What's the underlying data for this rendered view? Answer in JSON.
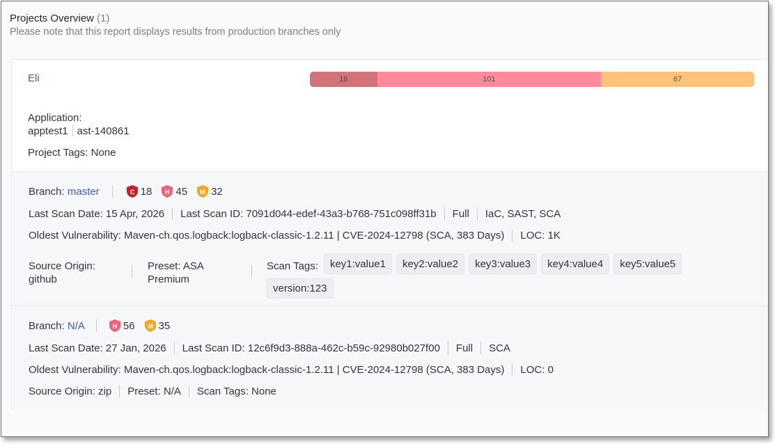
{
  "header": {
    "title": "Projects Overview",
    "count": "(1)",
    "subtitle": "Please note that this report displays results from production branches only"
  },
  "project": {
    "name": "Eli",
    "severity_bar": {
      "critical": 18,
      "high": 101,
      "medium": 67,
      "colors": {
        "critical": "#d2737a",
        "high": "#ff8a9c",
        "medium": "#ffc37a"
      }
    },
    "application_label": "Application:",
    "applications": [
      "apptest1",
      "ast-140861"
    ],
    "project_tags_label": "Project Tags:",
    "project_tags_value": "None"
  },
  "branches": [
    {
      "branch_label": "Branch:",
      "branch_name": "master",
      "severities": [
        {
          "letter": "C",
          "count": "18",
          "color": "#c4202b"
        },
        {
          "letter": "H",
          "count": "45",
          "color": "#f0627a"
        },
        {
          "letter": "M",
          "count": "32",
          "color": "#f5a623"
        }
      ],
      "last_scan_date": "Last Scan Date: 15 Apr, 2026",
      "last_scan_id": "Last Scan ID: 7091d044-edef-43a3-b768-751c098ff31b",
      "scan_type": "Full",
      "engines": "IaC, SAST, SCA",
      "oldest_vuln": "Oldest Vulnerability: Maven-ch.qos.logback:logback-classic-1.2.11 | CVE-2024-12798 (SCA, 383 Days)",
      "loc": "LOC: 1K",
      "source_origin_label": "Source Origin:",
      "source_origin_value": "github",
      "preset_label": "Preset: ASA",
      "preset_value": "Premium",
      "scan_tags_label": "Scan Tags:",
      "scan_tags": [
        "key1:value1",
        "key2:value2",
        "key3:value3",
        "key4:value4",
        "key5:value5",
        "version:123"
      ]
    },
    {
      "branch_label": "Branch:",
      "branch_name": "N/A",
      "severities": [
        {
          "letter": "H",
          "count": "56",
          "color": "#f0627a"
        },
        {
          "letter": "M",
          "count": "35",
          "color": "#f5a623"
        }
      ],
      "last_scan_date": "Last Scan Date: 27 Jan, 2026",
      "last_scan_id": "Last Scan ID: 12c6f9d3-888a-462c-b59c-92980b027f00",
      "scan_type": "Full",
      "engines": "SCA",
      "oldest_vuln": "Oldest Vulnerability: Maven-ch.qos.logback:logback-classic-1.2.11 | CVE-2024-12798 (SCA, 383 Days)",
      "loc": "LOC: 0",
      "source_origin": "Source Origin: zip",
      "preset": "Preset: N/A",
      "scan_tags": "Scan Tags: None"
    }
  ]
}
